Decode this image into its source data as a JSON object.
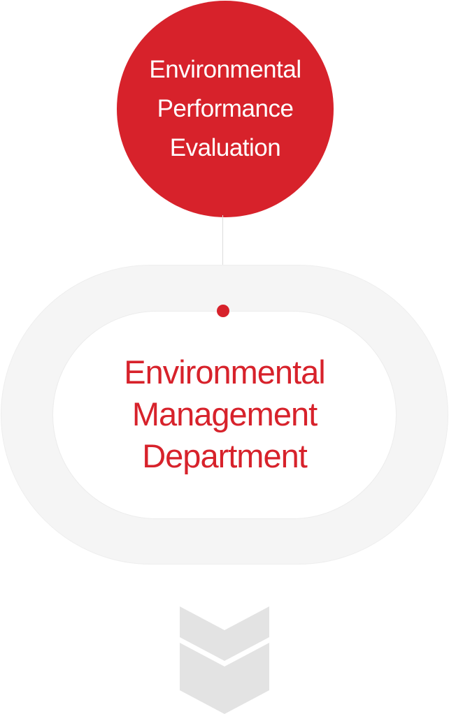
{
  "top_node": {
    "lines": [
      "Environmental",
      "Performance",
      "Evaluation"
    ],
    "color": "#d7222b"
  },
  "center_node": {
    "lines": [
      "Environmental",
      "Management",
      "Department"
    ],
    "color": "#d7222b"
  },
  "colors": {
    "accent": "#d7222b",
    "ring": "#f5f5f5",
    "chevron": "#e3e3e3",
    "line": "#dcdcdc"
  },
  "icons": {
    "bottom": "double-chevron-down-icon"
  }
}
